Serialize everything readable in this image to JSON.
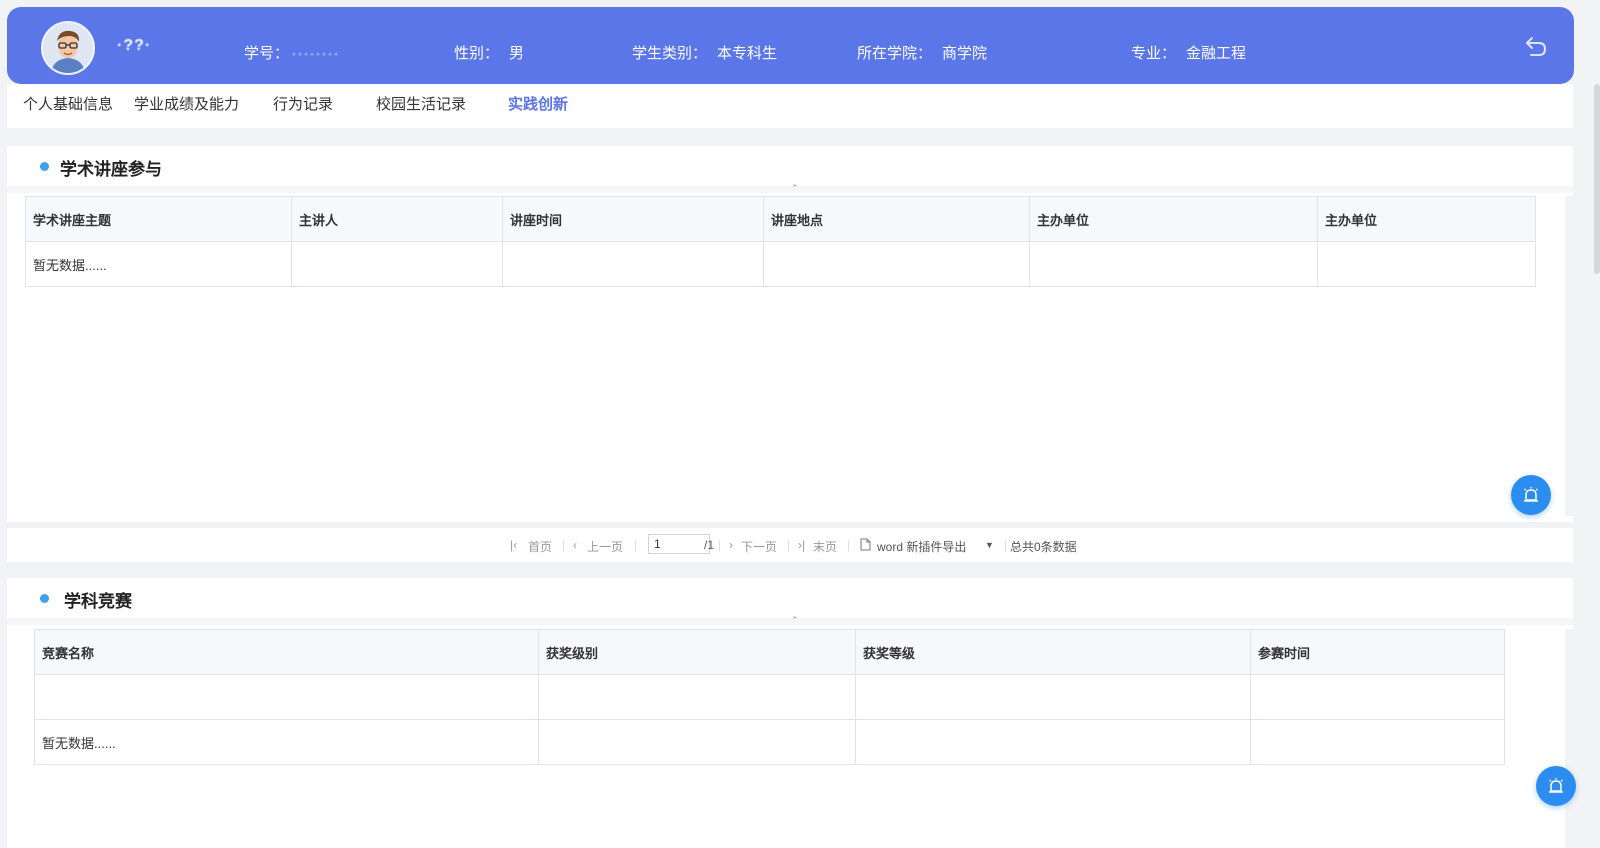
{
  "header": {
    "name": "·??·",
    "fields": [
      {
        "label": "学号：",
        "value": "········"
      },
      {
        "label": "性别：",
        "value": "男"
      },
      {
        "label": "学生类别：",
        "value": "本专科生"
      },
      {
        "label": "所在学院：",
        "value": "商学院"
      },
      {
        "label": "专业：",
        "value": "金融工程"
      }
    ]
  },
  "tabs": [
    {
      "label": "个人基础信息"
    },
    {
      "label": "学业成绩及能力"
    },
    {
      "label": "行为记录"
    },
    {
      "label": "校园生活记录"
    },
    {
      "label": "实践创新"
    }
  ],
  "section1": {
    "title": "学术讲座参与",
    "columns": [
      "学术讲座主题",
      "主讲人",
      "讲座时间",
      "讲座地点",
      "主办单位",
      "主办单位"
    ],
    "empty_text": "暂无数据......"
  },
  "pager": {
    "first": "首页",
    "prev": "上一页",
    "page_value": "1",
    "total_pages": "/1",
    "next": "下一页",
    "last": "末页",
    "export": "word 新插件导出",
    "total": "总共0条数据"
  },
  "section2": {
    "title": "学科竞赛",
    "columns": [
      "竞赛名称",
      "获奖级别",
      "获奖等级",
      "参赛时间"
    ],
    "empty_text": "暂无数据......"
  },
  "icons": {
    "back": "back-arrow-icon",
    "fab": "alarm-icon",
    "collapse": "double-chevron-up-icon"
  },
  "colors": {
    "header_bg": "#5b76e8",
    "active_tab": "#5b76e8",
    "bullet": "#3fa0f0",
    "fab": "#2d8cf0"
  }
}
